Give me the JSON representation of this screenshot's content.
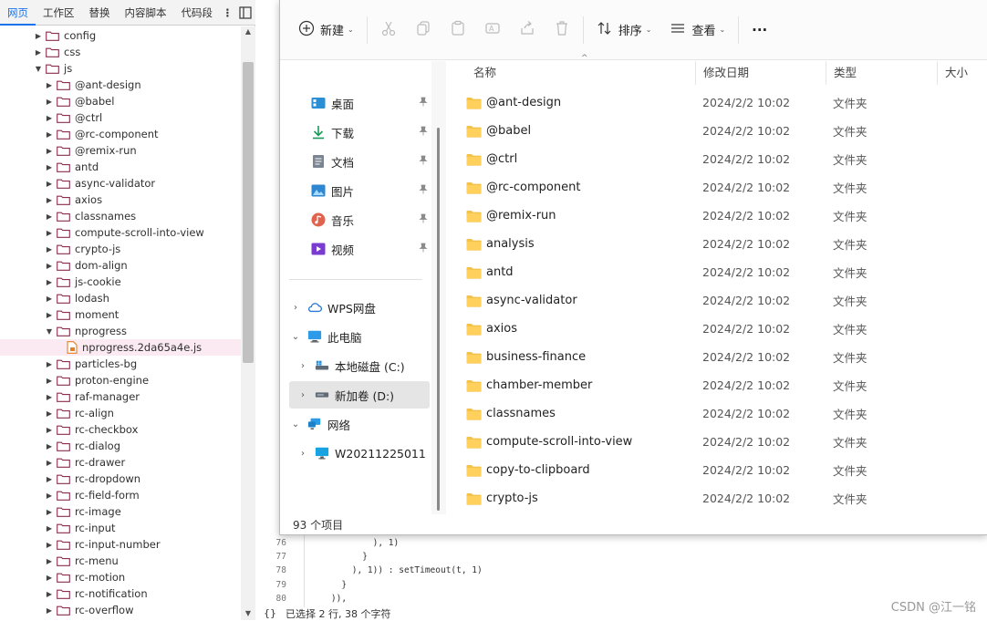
{
  "devtools": {
    "tabs": [
      "网页",
      "工作区",
      "替换",
      "内容脚本",
      "代码段"
    ],
    "active_tab": "网页",
    "more_label": "⋮",
    "tree": [
      {
        "label": "config",
        "depth": 2,
        "expanded": false,
        "kind": "folder"
      },
      {
        "label": "css",
        "depth": 2,
        "expanded": false,
        "kind": "folder"
      },
      {
        "label": "js",
        "depth": 2,
        "expanded": true,
        "kind": "folder"
      },
      {
        "label": "@ant-design",
        "depth": 3,
        "expanded": false,
        "kind": "folder"
      },
      {
        "label": "@babel",
        "depth": 3,
        "expanded": false,
        "kind": "folder"
      },
      {
        "label": "@ctrl",
        "depth": 3,
        "expanded": false,
        "kind": "folder"
      },
      {
        "label": "@rc-component",
        "depth": 3,
        "expanded": false,
        "kind": "folder"
      },
      {
        "label": "@remix-run",
        "depth": 3,
        "expanded": false,
        "kind": "folder"
      },
      {
        "label": "antd",
        "depth": 3,
        "expanded": false,
        "kind": "folder"
      },
      {
        "label": "async-validator",
        "depth": 3,
        "expanded": false,
        "kind": "folder"
      },
      {
        "label": "axios",
        "depth": 3,
        "expanded": false,
        "kind": "folder"
      },
      {
        "label": "classnames",
        "depth": 3,
        "expanded": false,
        "kind": "folder"
      },
      {
        "label": "compute-scroll-into-view",
        "depth": 3,
        "expanded": false,
        "kind": "folder"
      },
      {
        "label": "crypto-js",
        "depth": 3,
        "expanded": false,
        "kind": "folder"
      },
      {
        "label": "dom-align",
        "depth": 3,
        "expanded": false,
        "kind": "folder"
      },
      {
        "label": "js-cookie",
        "depth": 3,
        "expanded": false,
        "kind": "folder"
      },
      {
        "label": "lodash",
        "depth": 3,
        "expanded": false,
        "kind": "folder"
      },
      {
        "label": "moment",
        "depth": 3,
        "expanded": false,
        "kind": "folder"
      },
      {
        "label": "nprogress",
        "depth": 3,
        "expanded": true,
        "kind": "folder"
      },
      {
        "label": "nprogress.2da65a4e.js",
        "depth": 4,
        "expanded": false,
        "kind": "file",
        "selected": true
      },
      {
        "label": "particles-bg",
        "depth": 3,
        "expanded": false,
        "kind": "folder"
      },
      {
        "label": "proton-engine",
        "depth": 3,
        "expanded": false,
        "kind": "folder"
      },
      {
        "label": "raf-manager",
        "depth": 3,
        "expanded": false,
        "kind": "folder"
      },
      {
        "label": "rc-align",
        "depth": 3,
        "expanded": false,
        "kind": "folder"
      },
      {
        "label": "rc-checkbox",
        "depth": 3,
        "expanded": false,
        "kind": "folder"
      },
      {
        "label": "rc-dialog",
        "depth": 3,
        "expanded": false,
        "kind": "folder"
      },
      {
        "label": "rc-drawer",
        "depth": 3,
        "expanded": false,
        "kind": "folder"
      },
      {
        "label": "rc-dropdown",
        "depth": 3,
        "expanded": false,
        "kind": "folder"
      },
      {
        "label": "rc-field-form",
        "depth": 3,
        "expanded": false,
        "kind": "folder"
      },
      {
        "label": "rc-image",
        "depth": 3,
        "expanded": false,
        "kind": "folder"
      },
      {
        "label": "rc-input",
        "depth": 3,
        "expanded": false,
        "kind": "folder"
      },
      {
        "label": "rc-input-number",
        "depth": 3,
        "expanded": false,
        "kind": "folder"
      },
      {
        "label": "rc-menu",
        "depth": 3,
        "expanded": false,
        "kind": "folder"
      },
      {
        "label": "rc-motion",
        "depth": 3,
        "expanded": false,
        "kind": "folder"
      },
      {
        "label": "rc-notification",
        "depth": 3,
        "expanded": false,
        "kind": "folder"
      },
      {
        "label": "rc-overflow",
        "depth": 3,
        "expanded": false,
        "kind": "folder"
      }
    ]
  },
  "editor": {
    "lines": [
      {
        "num": "76",
        "code": "            ), 1)"
      },
      {
        "num": "77",
        "code": "          }"
      },
      {
        "num": "78",
        "code": "        ), 1)) : setTimeout(t, 1)"
      },
      {
        "num": "79",
        "code": "      }"
      },
      {
        "num": "80",
        "code": "    )),"
      }
    ],
    "status_braces": "{}",
    "status_text": "已选择 2 行, 38 个字符",
    "watermark": "CSDN @江一铭"
  },
  "explorer": {
    "toolbar": {
      "new_label": "新建",
      "sort_label": "排序",
      "view_label": "查看",
      "more_label": "···"
    },
    "nav_quick": [
      {
        "label": "桌面",
        "icon": "desktop-icon"
      },
      {
        "label": "下载",
        "icon": "download-icon"
      },
      {
        "label": "文档",
        "icon": "document-icon"
      },
      {
        "label": "图片",
        "icon": "pictures-icon"
      },
      {
        "label": "音乐",
        "icon": "music-icon"
      },
      {
        "label": "视频",
        "icon": "video-icon"
      }
    ],
    "nav_tree": [
      {
        "label": "WPS网盘",
        "icon": "cloud-icon",
        "expander": "›",
        "indent": 0
      },
      {
        "label": "此电脑",
        "icon": "computer-icon",
        "expander": "⌄",
        "indent": 0
      },
      {
        "label": "本地磁盘 (C:)",
        "icon": "drive-c-icon",
        "expander": "›",
        "indent": 1
      },
      {
        "label": "新加卷 (D:)",
        "icon": "drive-d-icon",
        "expander": "›",
        "indent": 1,
        "selected": true
      },
      {
        "label": "网络",
        "icon": "network-icon",
        "expander": "⌄",
        "indent": 0
      },
      {
        "label": "W20211225011",
        "icon": "monitor-icon",
        "expander": "›",
        "indent": 1
      }
    ],
    "columns": {
      "name": "名称",
      "modified": "修改日期",
      "type": "类型",
      "size": "大小"
    },
    "sort_caret": "^",
    "files": [
      {
        "name": "@ant-design",
        "modified": "2024/2/2 10:02",
        "type": "文件夹"
      },
      {
        "name": "@babel",
        "modified": "2024/2/2 10:02",
        "type": "文件夹"
      },
      {
        "name": "@ctrl",
        "modified": "2024/2/2 10:02",
        "type": "文件夹"
      },
      {
        "name": "@rc-component",
        "modified": "2024/2/2 10:02",
        "type": "文件夹"
      },
      {
        "name": "@remix-run",
        "modified": "2024/2/2 10:02",
        "type": "文件夹"
      },
      {
        "name": "analysis",
        "modified": "2024/2/2 10:02",
        "type": "文件夹"
      },
      {
        "name": "antd",
        "modified": "2024/2/2 10:02",
        "type": "文件夹"
      },
      {
        "name": "async-validator",
        "modified": "2024/2/2 10:02",
        "type": "文件夹"
      },
      {
        "name": "axios",
        "modified": "2024/2/2 10:02",
        "type": "文件夹"
      },
      {
        "name": "business-finance",
        "modified": "2024/2/2 10:02",
        "type": "文件夹"
      },
      {
        "name": "chamber-member",
        "modified": "2024/2/2 10:02",
        "type": "文件夹"
      },
      {
        "name": "classnames",
        "modified": "2024/2/2 10:02",
        "type": "文件夹"
      },
      {
        "name": "compute-scroll-into-view",
        "modified": "2024/2/2 10:02",
        "type": "文件夹"
      },
      {
        "name": "copy-to-clipboard",
        "modified": "2024/2/2 10:02",
        "type": "文件夹"
      },
      {
        "name": "crypto-js",
        "modified": "2024/2/2 10:02",
        "type": "文件夹"
      }
    ],
    "item_count": "93 个项目",
    "colors": {
      "folder": "#f3c24a",
      "accent": "#0067c0",
      "selection": "#e5e5e5"
    }
  }
}
